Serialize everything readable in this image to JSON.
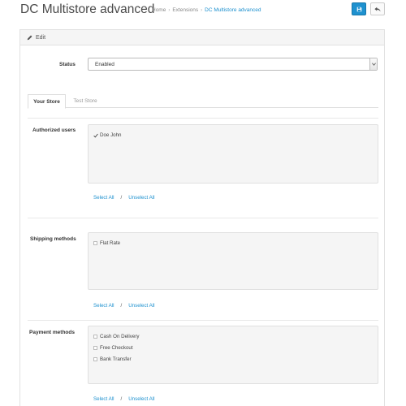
{
  "header": {
    "title": "DC Multistore advanced",
    "breadcrumb": [
      "Home",
      "Extensions",
      "DC Multistore advanced"
    ],
    "save_icon": "save-icon",
    "back_icon": "reply-icon"
  },
  "panel": {
    "heading": "Edit",
    "heading_icon": "pencil-icon"
  },
  "status": {
    "label": "Status",
    "value": "Enabled"
  },
  "tabs": [
    {
      "label": "Your Store",
      "active": true
    },
    {
      "label": "Test Store",
      "active": false
    }
  ],
  "sections": {
    "users": {
      "label": "Authorized users",
      "items": [
        {
          "label": "Doe John",
          "checked": true
        }
      ],
      "select_all": "Select All",
      "unselect_all": "Unselect All",
      "separator": "/"
    },
    "shipping": {
      "label": "Shipping methods",
      "items": [
        {
          "label": "Flat Rate",
          "checked": false
        }
      ],
      "select_all": "Select All",
      "unselect_all": "Unselect All",
      "separator": "/"
    },
    "payment": {
      "label": "Payment methods",
      "items": [
        {
          "label": "Cash On Delivery",
          "checked": false
        },
        {
          "label": "Free Checkout",
          "checked": false
        },
        {
          "label": "Bank Transfer",
          "checked": false
        }
      ],
      "select_all": "Select All",
      "unselect_all": "Unselect All",
      "separator": "/"
    }
  },
  "colors": {
    "primary": "#1e91cf",
    "panel_heading_bg": "#f5f5f5",
    "well_bg": "#f5f5f5"
  }
}
